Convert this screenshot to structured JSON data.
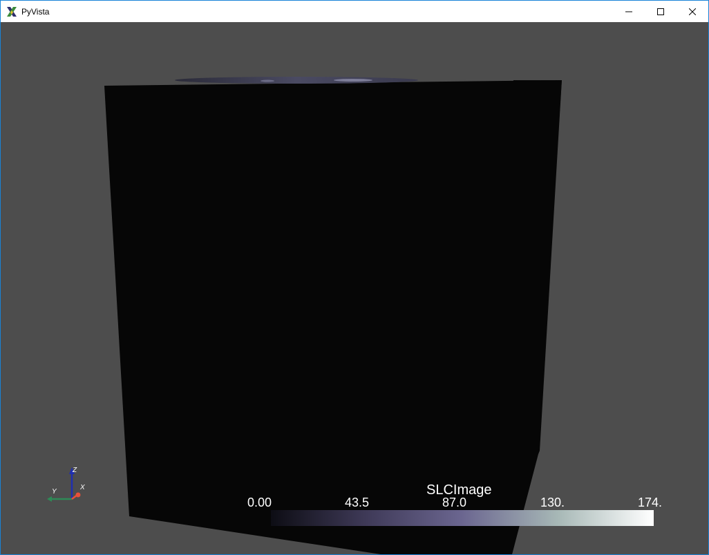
{
  "window": {
    "title": "PyVista",
    "minimize_icon": "minimize-icon",
    "maximize_icon": "maximize-icon",
    "close_icon": "close-icon"
  },
  "scene": {
    "background_color": "#4d4d4d",
    "volume_color": "#060606",
    "top_slice_color": "#3a3a4e"
  },
  "scalar_bar": {
    "title": "SLCImage",
    "ticks": [
      "0.00",
      "43.5",
      "87.0",
      "130.",
      "174."
    ],
    "colors": [
      "#0d0d14",
      "#3f3a58",
      "#6b6690",
      "#a7b8b6",
      "#ffffff"
    ]
  },
  "orientation_axes": {
    "x_label": "X",
    "y_label": "Y",
    "z_label": "Z",
    "x_color": "#e8503a",
    "y_color": "#2e8b57",
    "z_color": "#1f2fb0"
  }
}
